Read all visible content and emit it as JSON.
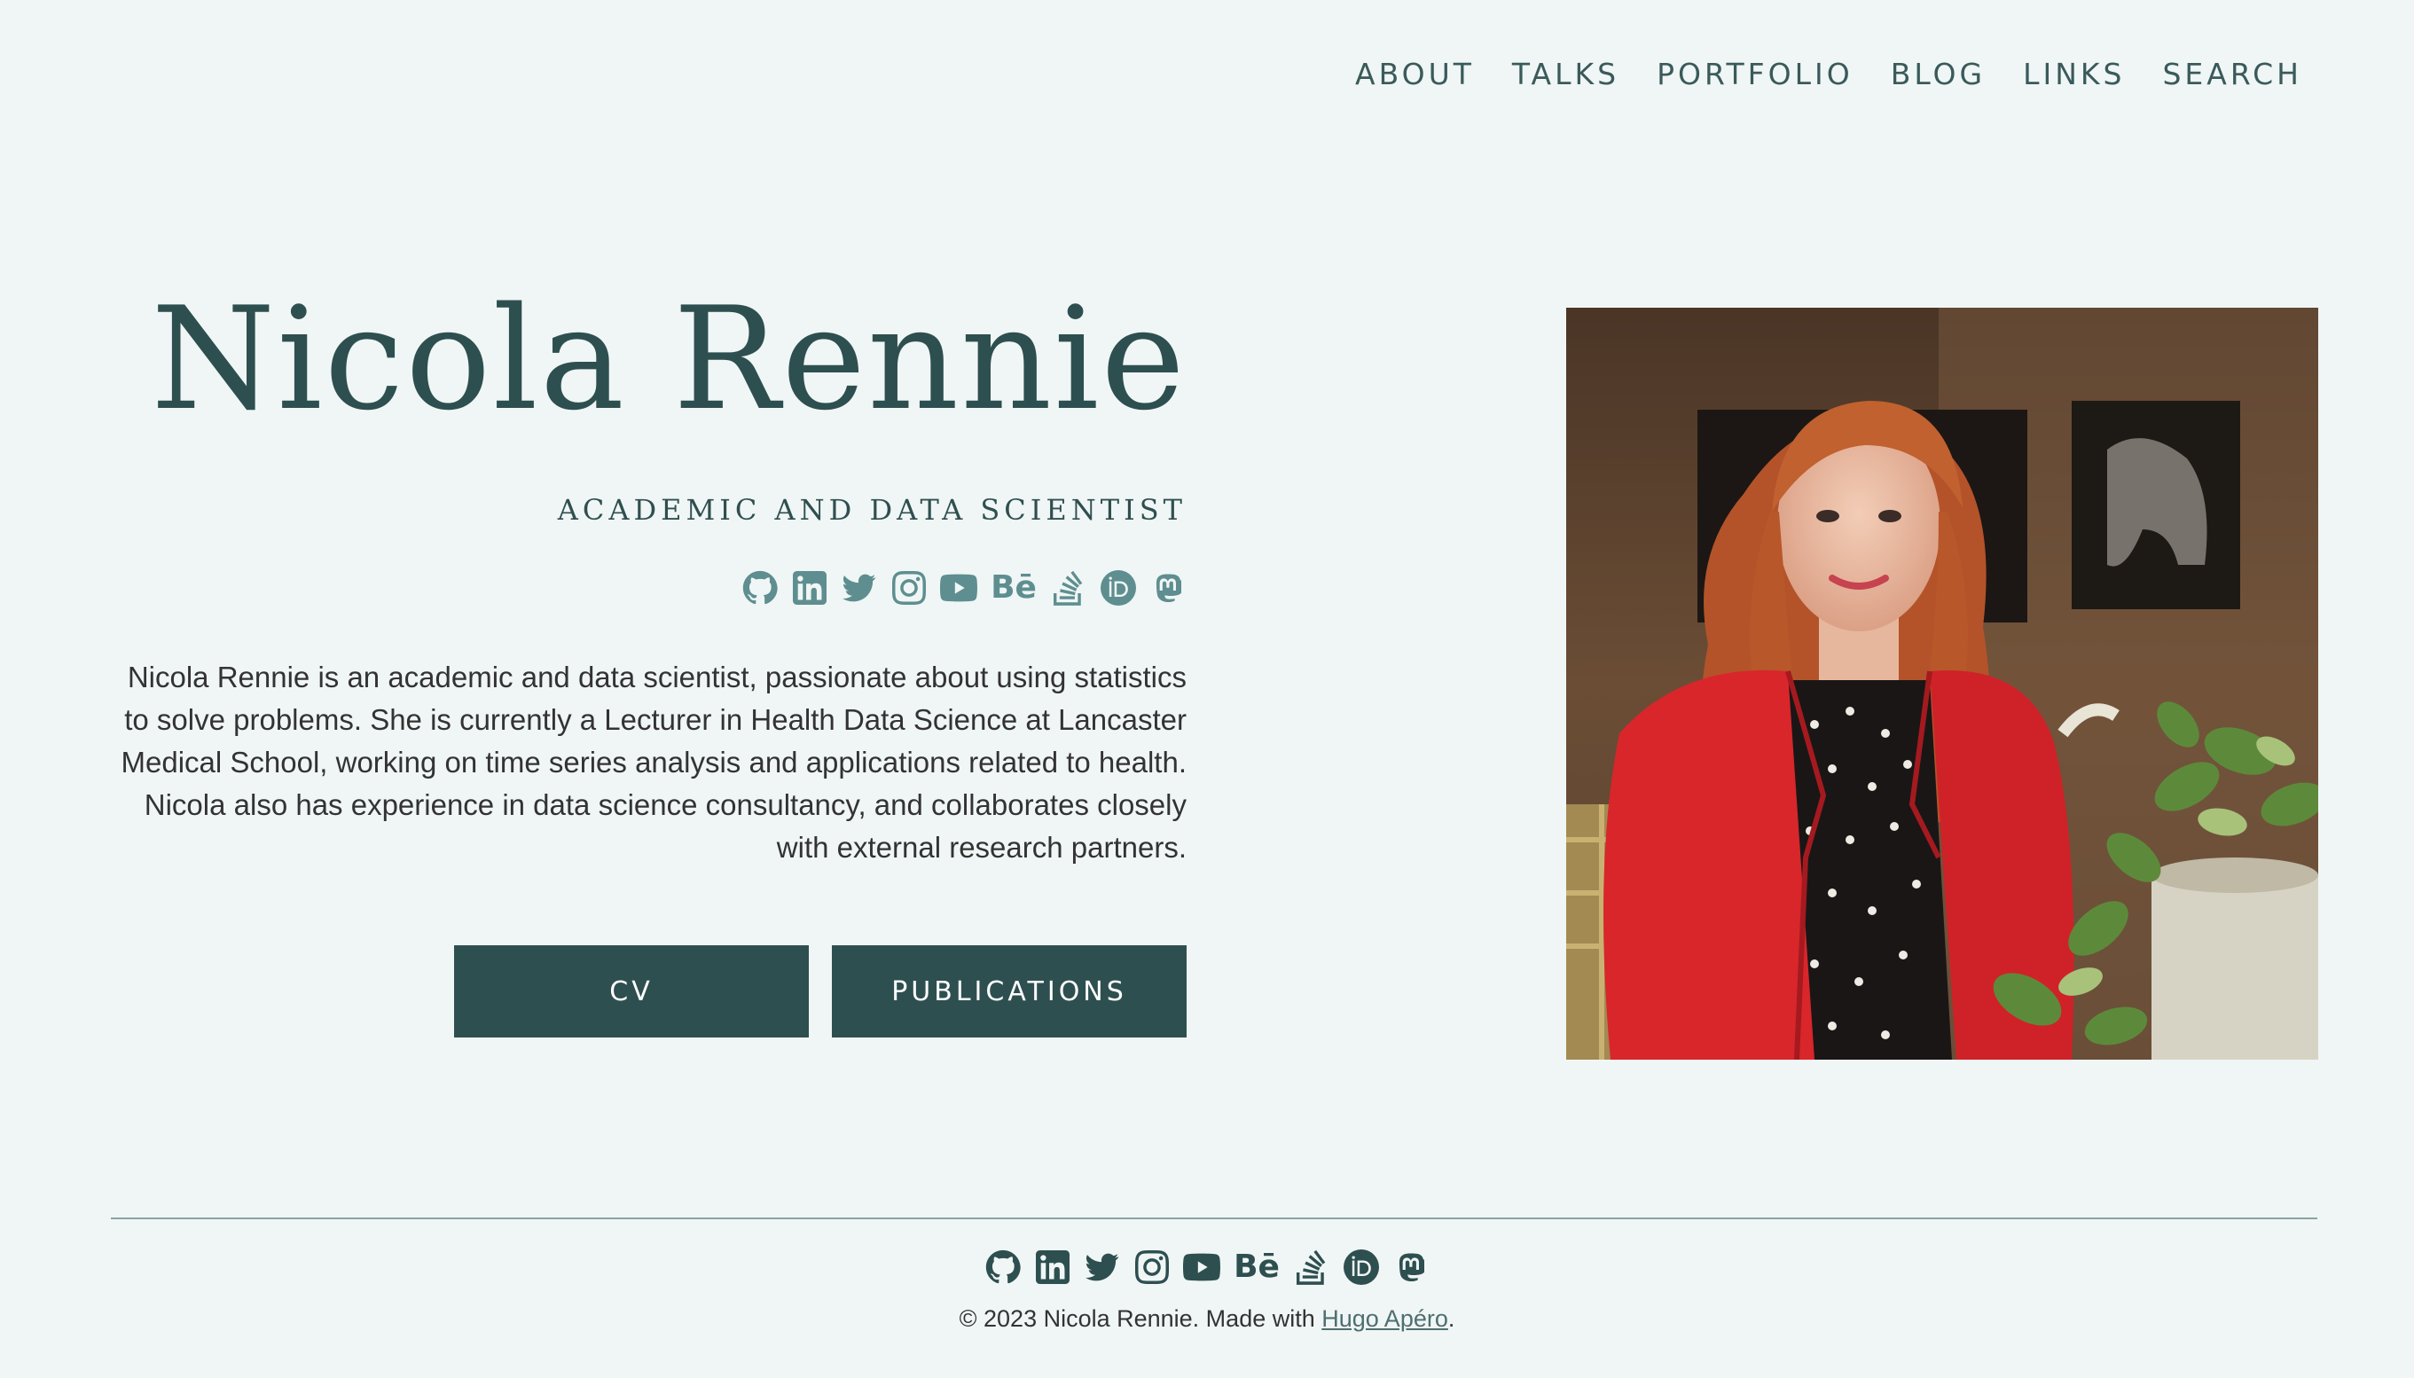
{
  "nav": {
    "items": [
      {
        "label": "ABOUT"
      },
      {
        "label": "TALKS"
      },
      {
        "label": "PORTFOLIO"
      },
      {
        "label": "BLOG"
      },
      {
        "label": "LINKS"
      },
      {
        "label": "SEARCH"
      }
    ]
  },
  "hero": {
    "name": "Nicola Rennie",
    "subtitle": "ACADEMIC AND DATA SCIENTIST",
    "bio": "Nicola Rennie is an academic and data scientist, passionate about using statistics to solve problems. She is currently a Lecturer in Health Data Science at Lancaster Medical School, working on time series analysis and applications related to health. Nicola also has experience in data science consultancy, and collaborates closely with external research partners.",
    "buttons": {
      "cv": "CV",
      "publications": "PUBLICATIONS"
    },
    "social_icons": [
      "github-icon",
      "linkedin-icon",
      "twitter-icon",
      "instagram-icon",
      "youtube-icon",
      "behance-icon",
      "stackoverflow-icon",
      "orcid-icon",
      "mastodon-icon"
    ]
  },
  "footer": {
    "copyright_prefix": "© 2023 Nicola Rennie. Made with ",
    "link_text": "Hugo Apéro",
    "copyright_suffix": "."
  },
  "colors": {
    "background": "#f0f6f5",
    "accent": "#2e4f50",
    "icon_light": "#5e8e90"
  }
}
